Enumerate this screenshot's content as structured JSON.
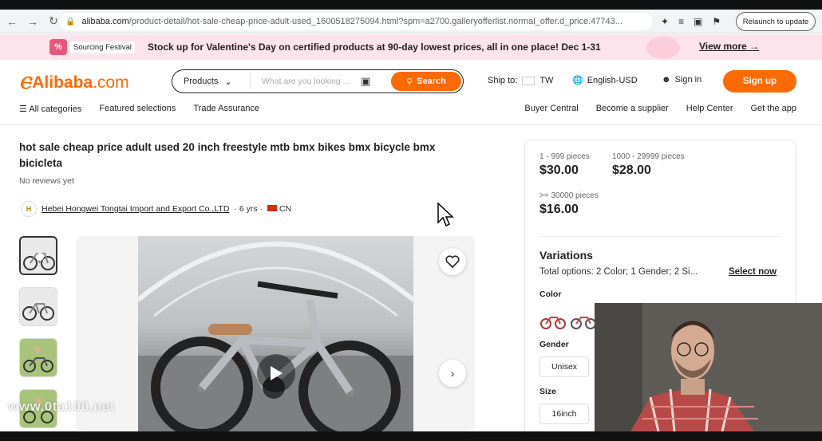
{
  "browser": {
    "url_host": "alibaba.com",
    "url_path": "/product-detail/hot-sale-cheap-price-adult-used_1600518275094.html?spm=a2700.galleryofferlist.normal_offer.d_price.47743...",
    "relaunch_label": "Relaunch to update"
  },
  "promo": {
    "festival_label": "Sourcing Festival",
    "message": "Stock up for Valentine's Day on certified products at 90-day lowest prices, all in one place! Dec 1-31",
    "view_more": "View more"
  },
  "header": {
    "logo_main": "Alibaba",
    "logo_suffix": ".com",
    "search": {
      "category": "Products",
      "placeholder": "What are you looking ...",
      "button": "Search"
    },
    "ship_to_label": "Ship to:",
    "ship_to_value": "TW",
    "language": "English-USD",
    "sign_in": "Sign in",
    "sign_up": "Sign up",
    "subnav_left": [
      "All categories",
      "Featured selections",
      "Trade Assurance"
    ],
    "subnav_right": [
      "Buyer Central",
      "Become a supplier",
      "Help Center",
      "Get the app"
    ]
  },
  "product": {
    "title": "hot sale cheap price adult used 20 inch freestyle mtb bmx bikes bmx bicycle bmx bicicleta",
    "reviews": "No reviews yet",
    "supplier_name": "Hebei Hongwei Tongtai Import and Export Co.,LTD",
    "supplier_meta": "· 6 yrs ·",
    "supplier_country": "CN"
  },
  "pricing": {
    "tiers": [
      {
        "qty": "1 - 999 pieces",
        "price": "$30.00"
      },
      {
        "qty": "1000 - 29999 pieces",
        "price": "$28.00"
      },
      {
        "qty": ">= 30000 pieces",
        "price": "$16.00"
      }
    ]
  },
  "variations": {
    "title": "Variations",
    "total": "Total options: 2 Color; 1 Gender; 2 Si...",
    "select_now": "Select now",
    "color_label": "Color",
    "gender_label": "Gender",
    "gender_value": "Unisex",
    "size_label": "Size",
    "size_value": "16inch"
  },
  "watermark": "www.0ta100.net",
  "colors": {
    "accent": "#ff6a00",
    "promo_bg": "#fde3ec"
  }
}
